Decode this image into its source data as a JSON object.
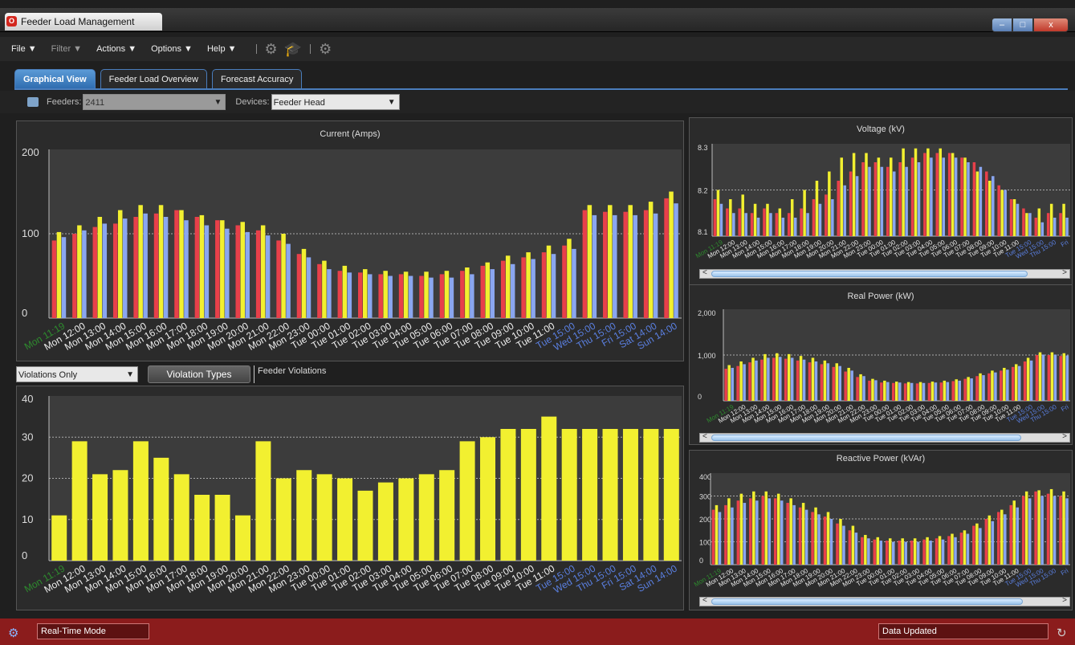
{
  "window": {
    "title": "Feeder Load Management",
    "min": "–",
    "max": "□",
    "close": "x"
  },
  "menu": {
    "file": "File ▼",
    "filter": "Filter ▼",
    "actions": "Actions ▼",
    "options": "Options ▼",
    "help": "Help ▼"
  },
  "tabs": [
    "Graphical View",
    "Feeder Load Overview",
    "Forecast Accuracy"
  ],
  "toolbar": {
    "feeders_label": "Feeders:",
    "feeders_value": "2411",
    "devices_label": "Devices:",
    "devices_value": "Feeder Head"
  },
  "violations": {
    "filter_value": "Violations Only",
    "button": "Violation Types",
    "label": "Feeder Violations"
  },
  "status": {
    "mode": "Real-Time Mode",
    "message": "Data Updated"
  },
  "colors": {
    "red": "#e8404a",
    "yellow": "#f2f030",
    "blue": "#8aa6f0",
    "green": "#2e8b2e",
    "date_blue": "#5a7fe0"
  },
  "main_labels": [
    "Mon 11:19",
    "Mon 12:00",
    "Mon 13:00",
    "Mon 14:00",
    "Mon 15:00",
    "Mon 16:00",
    "Mon 17:00",
    "Mon 18:00",
    "Mon 19:00",
    "Mon 20:00",
    "Mon 21:00",
    "Mon 22:00",
    "Mon 23:00",
    "Tue 00:00",
    "Tue 01:00",
    "Tue 02:00",
    "Tue 03:00",
    "Tue 04:00",
    "Tue 05:00",
    "Tue 06:00",
    "Tue 07:00",
    "Tue 08:00",
    "Tue 09:00",
    "Tue 10:00",
    "Tue 11:00",
    "Tue 15:00",
    "Wed 15:00",
    "Thu 15:00",
    "Fri 15:00",
    "Sat 14:00",
    "Sun 14:00"
  ],
  "small_labels": [
    "Mon 11:19",
    "Mon 12:00",
    "Mon 13:00",
    "Mon 14:00",
    "Mon 15:00",
    "Mon 16:00",
    "Mon 17:00",
    "Mon 18:00",
    "Mon 19:00",
    "Mon 20:00",
    "Mon 21:00",
    "Mon 22:00",
    "Mon 23:00",
    "Tue 00:00",
    "Tue 01:00",
    "Tue 02:00",
    "Tue 03:00",
    "Tue 04:00",
    "Tue 05:00",
    "Tue 06:00",
    "Tue 07:00",
    "Tue 08:00",
    "Tue 09:00",
    "Tue 10:00",
    "Tue 11:00",
    "Tue 15:00",
    "Wed 15:00",
    "Thu 15:00",
    "Fri"
  ],
  "chart_data": [
    {
      "id": "current",
      "type": "bar",
      "title": "Current (Amps)",
      "ylim": [
        0,
        200
      ],
      "yticks": [
        "200",
        "100",
        "0"
      ],
      "grid": "dotted at 100",
      "series": [
        {
          "color": "red",
          "values": [
            92,
            100,
            108,
            112,
            120,
            124,
            128,
            120,
            116,
            110,
            104,
            92,
            76,
            64,
            56,
            54,
            52,
            52,
            50,
            52,
            56,
            62,
            68,
            72,
            78,
            86,
            128,
            126,
            126,
            128,
            142
          ]
        },
        {
          "color": "yellow",
          "values": [
            102,
            110,
            120,
            128,
            134,
            134,
            128,
            122,
            116,
            114,
            110,
            100,
            82,
            68,
            62,
            58,
            56,
            55,
            55,
            56,
            60,
            66,
            74,
            78,
            86,
            94,
            134,
            134,
            134,
            138,
            150
          ]
        },
        {
          "color": "blue",
          "values": [
            96,
            104,
            112,
            118,
            124,
            120,
            116,
            110,
            106,
            102,
            98,
            88,
            72,
            58,
            54,
            52,
            50,
            50,
            48,
            48,
            52,
            58,
            64,
            70,
            76,
            82,
            122,
            122,
            122,
            124,
            136
          ]
        }
      ]
    },
    {
      "id": "violations",
      "type": "bar",
      "title": "Feeder Violations",
      "ylim": [
        0,
        40
      ],
      "yticks": [
        "40",
        "30",
        "20",
        "10",
        "0"
      ],
      "series": [
        {
          "color": "yellow",
          "values": [
            11,
            29,
            21,
            22,
            29,
            25,
            21,
            16,
            16,
            11,
            29,
            20,
            22,
            21,
            20,
            17,
            19,
            20,
            21,
            22,
            29,
            30,
            32,
            32,
            35,
            32,
            32,
            32,
            32,
            32,
            32
          ]
        }
      ]
    },
    {
      "id": "voltage",
      "type": "bar",
      "title": "Voltage (kV)",
      "ylim": [
        8.1,
        8.3
      ],
      "yticks": [
        "8.3",
        "8.2",
        "8.1"
      ],
      "series": [
        {
          "color": "red",
          "values": [
            8.18,
            8.16,
            8.16,
            8.15,
            8.16,
            8.15,
            8.15,
            8.16,
            8.18,
            8.19,
            8.22,
            8.24,
            8.26,
            8.26,
            8.25,
            8.26,
            8.27,
            8.28,
            8.28,
            8.28,
            8.27,
            8.26,
            8.24,
            8.21,
            8.18,
            8.16,
            8.14,
            8.15,
            8.15
          ]
        },
        {
          "color": "yellow",
          "values": [
            8.2,
            8.18,
            8.19,
            8.17,
            8.17,
            8.16,
            8.18,
            8.2,
            8.22,
            8.24,
            8.27,
            8.28,
            8.28,
            8.27,
            8.27,
            8.29,
            8.29,
            8.29,
            8.29,
            8.28,
            8.27,
            8.24,
            8.22,
            8.2,
            8.18,
            8.15,
            8.16,
            8.17,
            8.17
          ]
        },
        {
          "color": "blue",
          "values": [
            8.17,
            8.15,
            8.15,
            8.14,
            8.15,
            8.14,
            8.14,
            8.15,
            8.17,
            8.18,
            8.21,
            8.23,
            8.25,
            8.25,
            8.24,
            8.25,
            8.26,
            8.27,
            8.27,
            8.27,
            8.26,
            8.25,
            8.23,
            8.2,
            8.17,
            8.15,
            8.13,
            8.14,
            8.14
          ]
        }
      ]
    },
    {
      "id": "real_power",
      "type": "bar",
      "title": "Real Power (kW)",
      "ylim": [
        0,
        2000
      ],
      "yticks": [
        "2,000",
        "1,000",
        "0"
      ],
      "series": [
        {
          "color": "red",
          "values": [
            700,
            760,
            840,
            900,
            940,
            920,
            880,
            840,
            800,
            740,
            640,
            520,
            440,
            400,
            390,
            380,
            380,
            390,
            400,
            430,
            480,
            540,
            600,
            660,
            740,
            860,
            1000,
            1000,
            980
          ]
        },
        {
          "color": "yellow",
          "values": [
            780,
            860,
            940,
            1020,
            1040,
            1020,
            980,
            940,
            880,
            820,
            720,
            580,
            480,
            440,
            420,
            410,
            410,
            420,
            440,
            470,
            520,
            600,
            660,
            720,
            800,
            940,
            1060,
            1060,
            1040
          ]
        },
        {
          "color": "blue",
          "values": [
            720,
            800,
            880,
            940,
            960,
            940,
            900,
            860,
            820,
            760,
            660,
            540,
            450,
            410,
            400,
            390,
            390,
            400,
            410,
            440,
            490,
            560,
            620,
            680,
            760,
            880,
            1010,
            1010,
            990
          ]
        }
      ]
    },
    {
      "id": "reactive_power",
      "type": "bar",
      "title": "Reactive Power (kVAr)",
      "ylim": [
        0,
        400
      ],
      "yticks": [
        "400",
        "300",
        "200",
        "100",
        "0"
      ],
      "series": [
        {
          "color": "red",
          "values": [
            240,
            260,
            280,
            290,
            300,
            290,
            270,
            250,
            230,
            210,
            180,
            150,
            120,
            110,
            105,
            105,
            105,
            110,
            115,
            125,
            140,
            170,
            200,
            230,
            260,
            300,
            320,
            310,
            300
          ]
        },
        {
          "color": "yellow",
          "values": [
            260,
            290,
            310,
            320,
            320,
            310,
            290,
            270,
            250,
            230,
            200,
            170,
            130,
            120,
            115,
            115,
            115,
            120,
            125,
            135,
            150,
            180,
            215,
            240,
            280,
            320,
            325,
            330,
            320
          ]
        },
        {
          "color": "blue",
          "values": [
            230,
            250,
            270,
            280,
            290,
            280,
            260,
            240,
            220,
            200,
            170,
            140,
            115,
            105,
            100,
            100,
            100,
            105,
            110,
            120,
            135,
            160,
            190,
            220,
            250,
            290,
            300,
            300,
            290
          ]
        }
      ]
    }
  ]
}
